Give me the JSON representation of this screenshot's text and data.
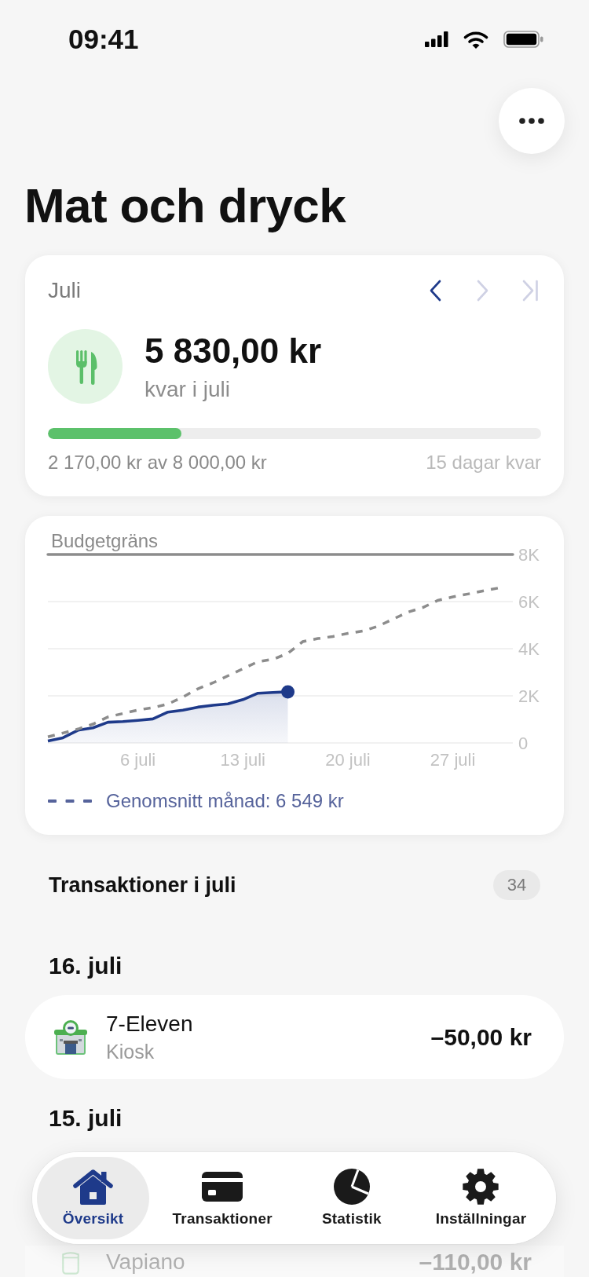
{
  "status_bar": {
    "time": "09:41"
  },
  "header": {
    "title": "Mat och dryck"
  },
  "budget": {
    "period": "Juli",
    "nav": [
      {
        "kind": "previous",
        "disabled": false
      },
      {
        "kind": "next",
        "disabled": true
      },
      {
        "kind": "last",
        "disabled": true
      }
    ],
    "remaining": "5 830,00 kr",
    "remaining_label": "kvar i juli",
    "level": 0.27,
    "spent": "2 170,00 kr av 8 000,00 kr",
    "days_left": "15 dagar kvar"
  },
  "chart": {
    "chart_data": {
      "type": "area",
      "categories": [
        null,
        null,
        null,
        null,
        null,
        null,
        "6 juli",
        null,
        null,
        null,
        null,
        null,
        null,
        "13 juli",
        null,
        null,
        null,
        null,
        null,
        null,
        "20 juli",
        null,
        null,
        null,
        null,
        null,
        null,
        "27 juli",
        null,
        null,
        null
      ],
      "series": [
        {
          "color": "#1e3a8a",
          "values": [
            80,
            220,
            540,
            640,
            880,
            910,
            960,
            1020,
            1310,
            1390,
            1520,
            1600,
            1660,
            1840,
            2110,
            2140,
            2170,
            null,
            null,
            null,
            null,
            null,
            null,
            null,
            null,
            null,
            null,
            null,
            null,
            null,
            null
          ]
        },
        {
          "name": "Genomsnitt månad: 6 549 kr",
          "type": "line",
          "color": "#8c8c8c",
          "line_style": "dashed",
          "values": [
            260,
            420,
            590,
            800,
            1100,
            1250,
            1400,
            1500,
            1650,
            1950,
            2300,
            2550,
            2850,
            3150,
            3450,
            3550,
            3800,
            4300,
            4430,
            4520,
            4650,
            4750,
            4950,
            5250,
            5550,
            5750,
            6050,
            6200,
            6320,
            6450,
            6570
          ]
        }
      ],
      "ylim": [
        0,
        8000
      ],
      "yticks": [
        {
          "value": 0,
          "label": "0"
        },
        {
          "value": 2000,
          "label": "2K"
        },
        {
          "value": 4000,
          "label": "4K"
        },
        {
          "value": 6000,
          "label": "6K"
        },
        {
          "value": 8000,
          "label": "8K"
        }
      ],
      "grid": true,
      "ref_lines": [
        {
          "axis": "y",
          "value": 8000,
          "label": "Budgetgräns"
        }
      ]
    }
  },
  "transactions": {
    "title": "Transaktioner i juli",
    "count": "34",
    "days": [
      {
        "date": "16. juli",
        "items": [
          {
            "kind": "store",
            "name": "7-Eleven",
            "category": "Kiosk",
            "amount": "–50,00 kr"
          }
        ]
      },
      {
        "date": "15. juli",
        "items": [
          {
            "kind": "cup",
            "name": "Vapiano",
            "amount": "–110,00 kr"
          }
        ]
      }
    ]
  },
  "tab_bar": {
    "tabs": [
      {
        "kind": "home",
        "label": "Översikt",
        "selected": true
      },
      {
        "kind": "card",
        "label": "Transaktioner",
        "selected": false
      },
      {
        "kind": "pie",
        "label": "Statistik",
        "selected": false
      },
      {
        "kind": "gear",
        "label": "Inställningar",
        "selected": false
      }
    ]
  }
}
